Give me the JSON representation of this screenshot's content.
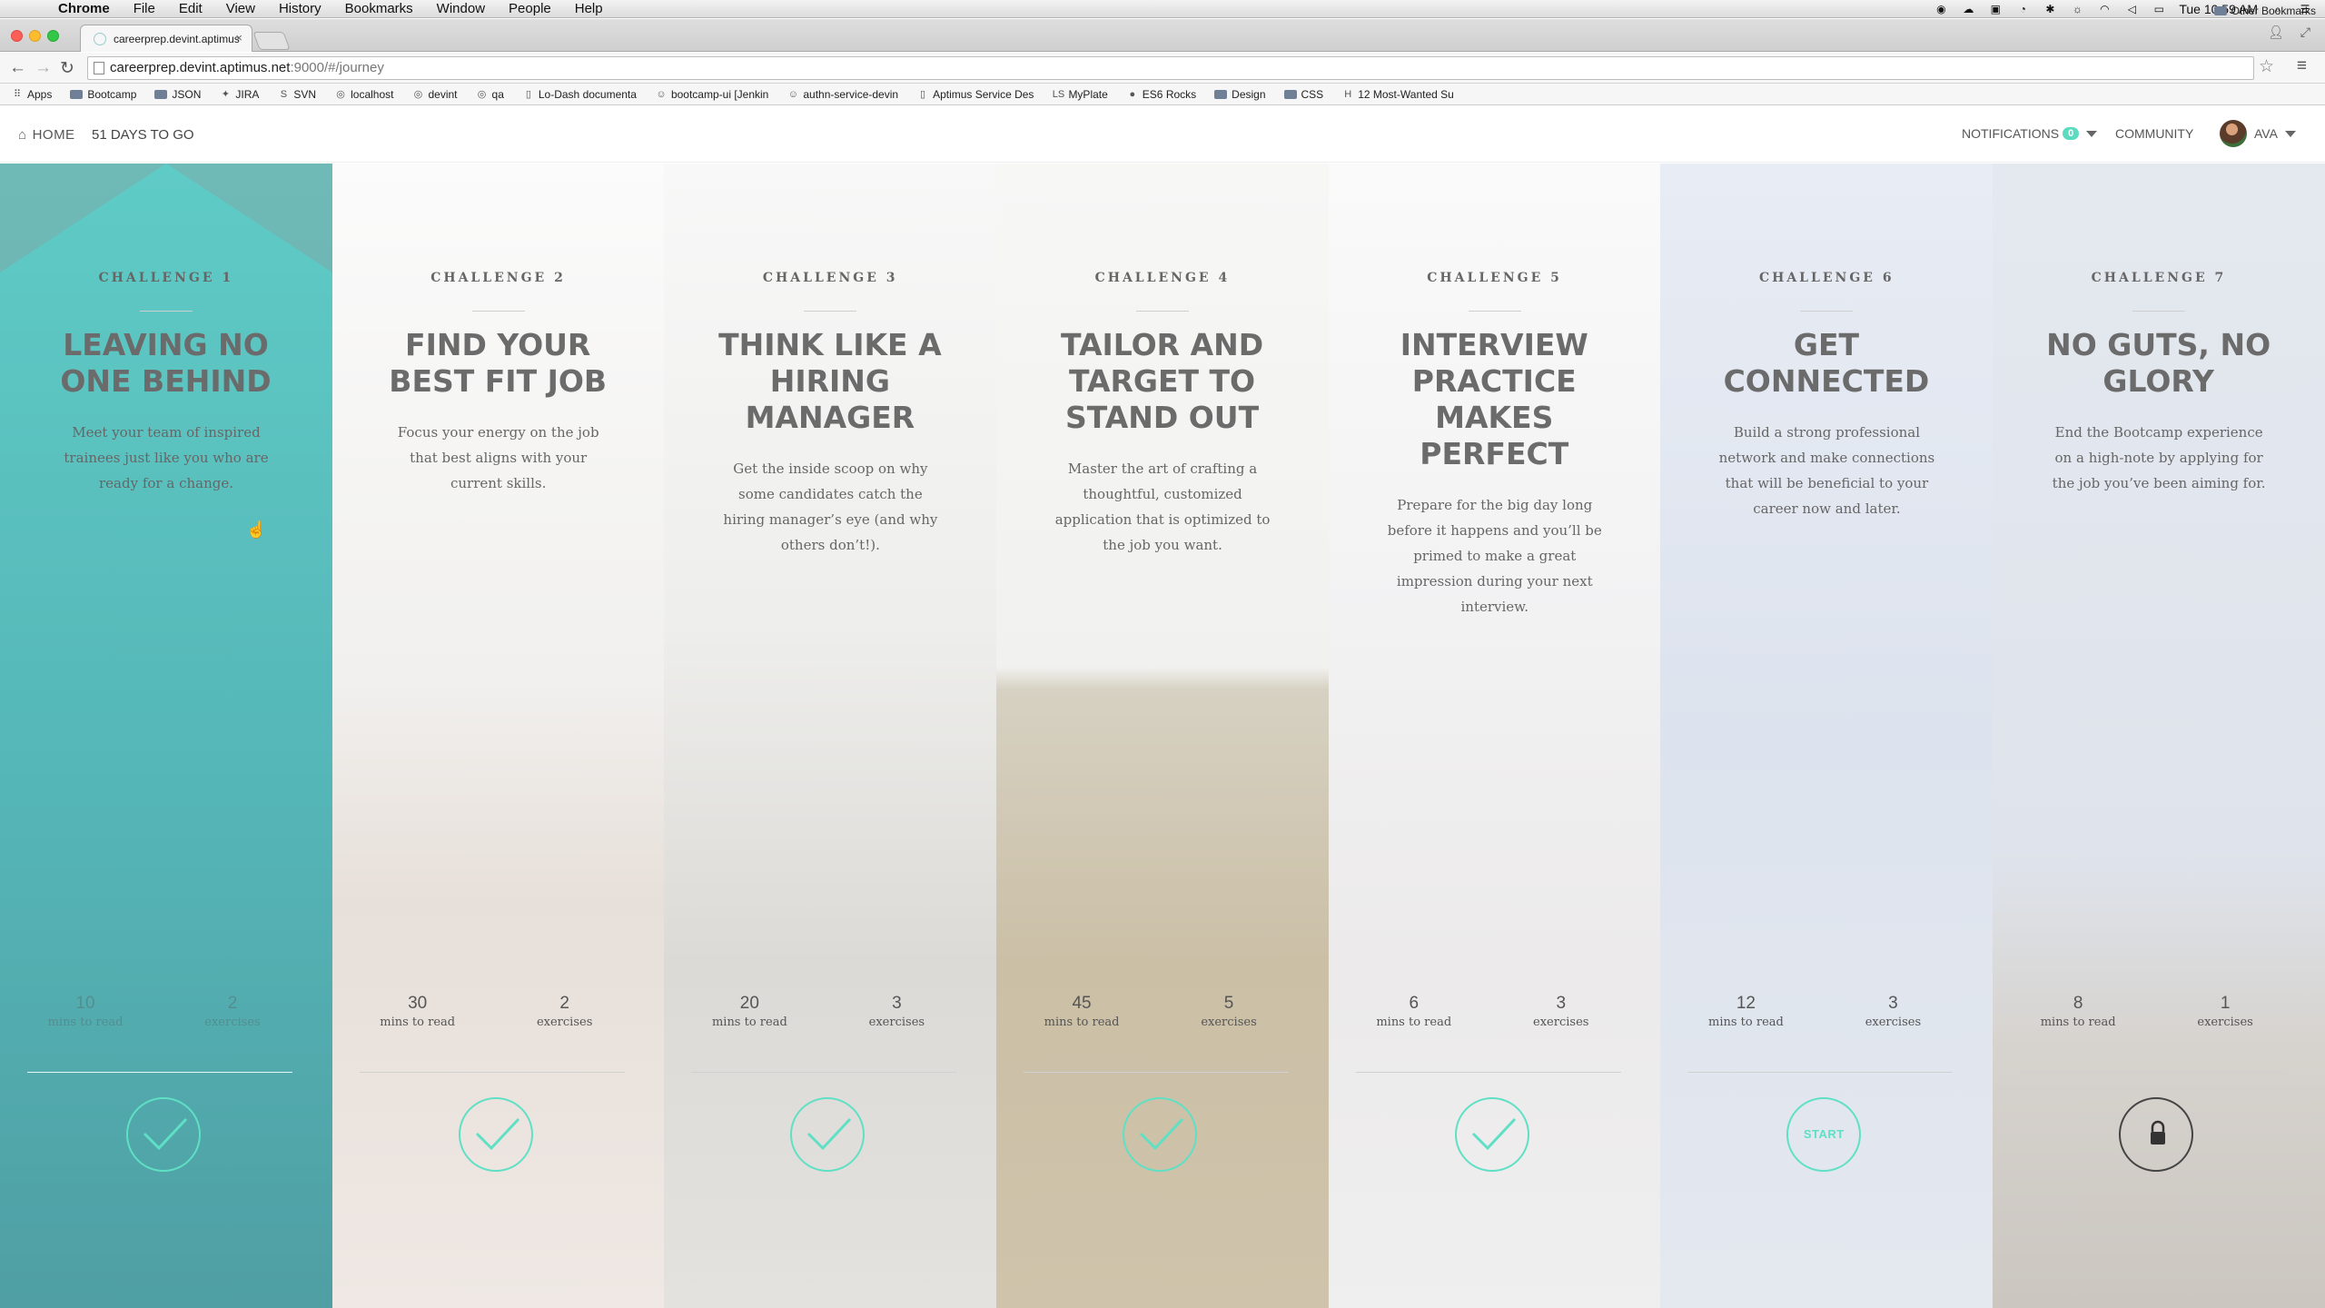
{
  "menubar": {
    "apple": "",
    "app": "Chrome",
    "menus": [
      "File",
      "Edit",
      "View",
      "History",
      "Bookmarks",
      "Window",
      "People",
      "Help"
    ],
    "clock": "Tue 10:59 AM"
  },
  "browser": {
    "tab_title": "careerprep.devint.aptimus",
    "tab_close": "×",
    "url_host": "careerprep.devint.aptimus.net",
    "url_path": ":9000/#/journey",
    "bookmarks": [
      {
        "label": "Apps",
        "icon": "apps-grid-icon"
      },
      {
        "label": "Bootcamp",
        "icon": "folder-icon"
      },
      {
        "label": "JSON",
        "icon": "folder-icon"
      },
      {
        "label": "JIRA",
        "icon": "jira-icon"
      },
      {
        "label": "SVN",
        "icon": "svn-icon"
      },
      {
        "label": "localhost",
        "icon": "globe-icon"
      },
      {
        "label": "devint",
        "icon": "globe-icon"
      },
      {
        "label": "qa",
        "icon": "globe-icon"
      },
      {
        "label": "Lo-Dash documenta",
        "icon": "page-icon"
      },
      {
        "label": "bootcamp-ui [Jenkin",
        "icon": "jenkins-icon"
      },
      {
        "label": "authn-service-devin",
        "icon": "jenkins-icon"
      },
      {
        "label": "Aptimus Service Des",
        "icon": "page-icon"
      },
      {
        "label": "MyPlate",
        "icon": "ls-icon"
      },
      {
        "label": "ES6 Rocks",
        "icon": "es6-icon"
      },
      {
        "label": "Design",
        "icon": "folder-icon"
      },
      {
        "label": "CSS",
        "icon": "folder-icon"
      },
      {
        "label": "12 Most-Wanted Su",
        "icon": "h-icon"
      }
    ],
    "other_bookmarks": "Other Bookmarks"
  },
  "appnav": {
    "home": "HOME",
    "days_to_go": "51 DAYS TO GO",
    "notifications": "NOTIFICATIONS",
    "notifications_count": "0",
    "community": "COMMUNITY",
    "user": "AVA"
  },
  "challenges": [
    {
      "label": "CHALLENGE 1",
      "title": "LEAVING NO ONE BEHIND",
      "desc": "Meet your team of inspired trainees just like you who are ready for a change.",
      "mins": "10",
      "mins_label": "mins to read",
      "exercises": "2",
      "exercises_label": "exercises",
      "status": "complete",
      "status_icon": "checkmark-icon"
    },
    {
      "label": "CHALLENGE 2",
      "title": "FIND YOUR BEST FIT JOB",
      "desc": "Focus your energy on the job that best aligns with your current skills.",
      "mins": "30",
      "mins_label": "mins to read",
      "exercises": "2",
      "exercises_label": "exercises",
      "status": "complete",
      "status_icon": "checkmark-icon"
    },
    {
      "label": "CHALLENGE 3",
      "title": "THINK LIKE A HIRING MANAGER",
      "desc": "Get the inside scoop on why some candidates catch the hiring manager’s eye (and why others don’t!).",
      "mins": "20",
      "mins_label": "mins to read",
      "exercises": "3",
      "exercises_label": "exercises",
      "status": "complete",
      "status_icon": "checkmark-icon"
    },
    {
      "label": "CHALLENGE 4",
      "title": "TAILOR AND TARGET TO STAND OUT",
      "desc": "Master the art of crafting a thoughtful, customized application that is optimized to the job you want.",
      "mins": "45",
      "mins_label": "mins to read",
      "exercises": "5",
      "exercises_label": "exercises",
      "status": "complete",
      "status_icon": "checkmark-icon"
    },
    {
      "label": "CHALLENGE 5",
      "title": "INTERVIEW PRACTICE MAKES PERFECT",
      "desc": "Prepare for the big day long before it happens and you’ll be primed to make a great impression during your next interview.",
      "mins": "6",
      "mins_label": "mins to read",
      "exercises": "3",
      "exercises_label": "exercises",
      "status": "complete",
      "status_icon": "checkmark-icon"
    },
    {
      "label": "CHALLENGE 6",
      "title": "GET CONNECTED",
      "desc": "Build a strong professional network and make connections that will be beneficial to your career now and later.",
      "mins": "12",
      "mins_label": "mins to read",
      "exercises": "3",
      "exercises_label": "exercises",
      "status": "start",
      "status_label": "START"
    },
    {
      "label": "CHALLENGE 7",
      "title": "NO GUTS, NO GLORY",
      "desc": "End the Bootcamp experience on a high-note by applying for the job you’ve been aiming for.",
      "mins": "8",
      "mins_label": "mins to read",
      "exercises": "1",
      "exercises_label": "exercises",
      "status": "locked",
      "status_icon": "lock-icon"
    }
  ],
  "colors": {
    "accent": "#5fe0c4",
    "active_column": "#5fcac4",
    "title_text": "#6b6b6b"
  }
}
